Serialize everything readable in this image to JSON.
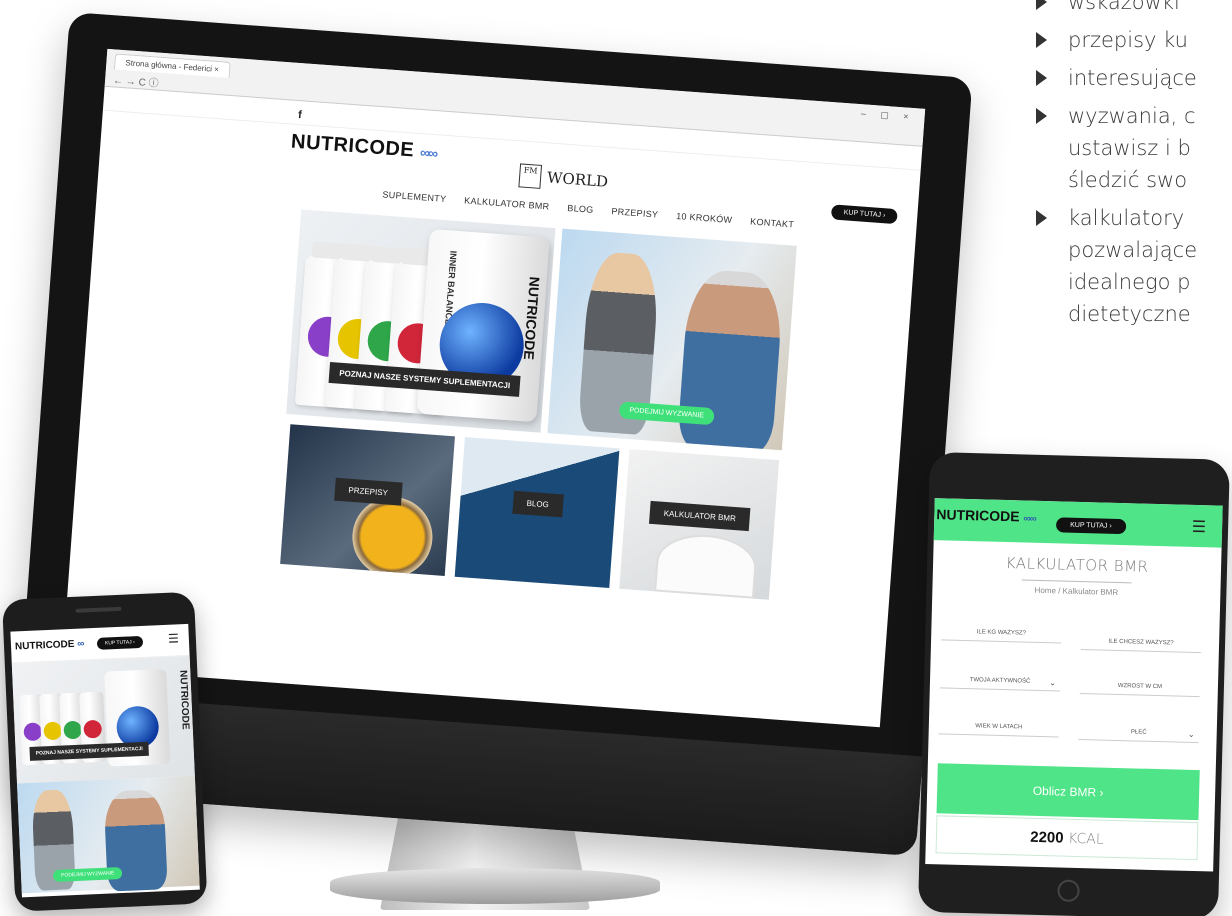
{
  "features": [
    "wskazówki",
    "przepisy ku",
    "interesujące",
    "wyzwania, c\nustawisz i b\nśledzić swo",
    "kalkulatory\npozwalające\nidealnego p\ndietetyczne"
  ],
  "desktop": {
    "tab_title": "Strona główna - Federici",
    "facebook": "f",
    "logo_text": "NUTRICODE",
    "fm_mark": "FM",
    "fm_world": "WORLD",
    "kup_label": "KUP TUTAJ ›",
    "nav": [
      "SUPLEMENTY",
      "KALKULATOR BMR",
      "BLOG",
      "PRZEPISY",
      "10 KROKÓW",
      "KONTAKT"
    ],
    "bottle_big_label": "INNER BALANCE",
    "bottle_brand": "NUTRICODE",
    "poznaj_label": "POZNAJ NASZE SYSTEMY SUPLEMENTACJI",
    "podejmij_label": "PODEJMIJ WYZWANIE",
    "tile_przepisy": "PRZEPISY",
    "tile_blog": "BLOG",
    "tile_bmr": "KALKULATOR BMR"
  },
  "tablet": {
    "logo_text": "NUTRICODE",
    "kup_label": "KUP TUTAJ ›",
    "menu_icon": "☰",
    "title": "KALKULATOR BMR",
    "breadcrumb": "Home  /  Kalkulator BMR",
    "fields": {
      "weight": "ILE KG WAŻYSZ?",
      "target": "ILE CHCESZ WAŻYSZ?",
      "activity": "TWOJA AKTYWNOŚĆ",
      "height": "WZROST W CM",
      "age": "WIEK W LATACH",
      "sex": "PŁEĆ"
    },
    "calc_button": "Oblicz BMR ›",
    "result_value": "2200",
    "result_unit": "KCAL"
  },
  "phone": {
    "logo_text": "NUTRICODE",
    "kup_label": "KUP TUTAJ ›",
    "menu_icon": "☰",
    "poznaj_label": "POZNAJ NASZE SYSTEMY SUPLEMENTACJI",
    "podejmij_label": "PODEJMIJ WYZWANIE",
    "brand_vertical": "NUTRICODE"
  },
  "colors": {
    "accent_green": "#4fe487",
    "dark": "#111111"
  }
}
